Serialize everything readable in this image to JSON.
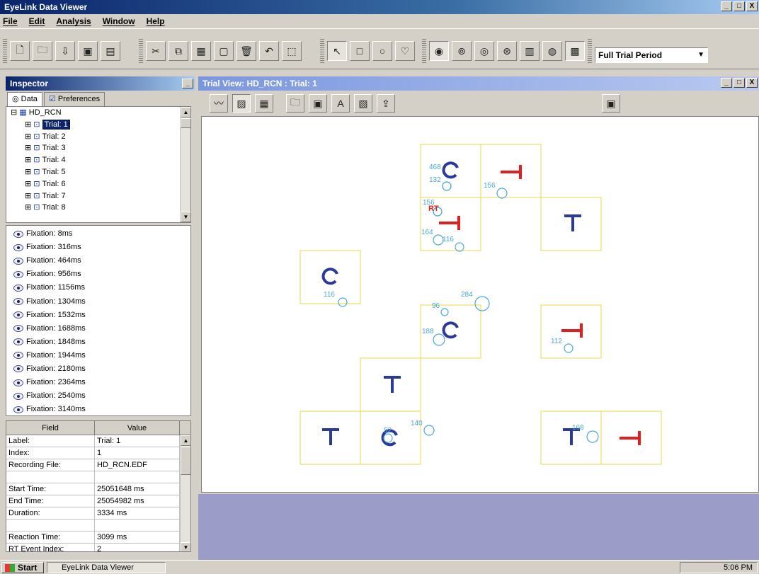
{
  "window": {
    "title": "EyeLink Data Viewer",
    "controls": [
      "_",
      "□",
      "X"
    ]
  },
  "menu": {
    "items": [
      "File",
      "Edit",
      "Analysis",
      "Window",
      "Help"
    ]
  },
  "toolbar": {
    "period_select": "Full Trial Period"
  },
  "inspector": {
    "title": "Inspector",
    "tabs": [
      "Data",
      "Preferences"
    ],
    "tree": {
      "root": "HD_RCN",
      "trials": [
        "Trial: 1",
        "Trial: 2",
        "Trial: 3",
        "Trial: 4",
        "Trial: 5",
        "Trial: 6",
        "Trial: 7",
        "Trial: 8"
      ]
    },
    "events": [
      "Fixation: 8ms",
      "Fixation: 316ms",
      "Fixation: 464ms",
      "Fixation: 956ms",
      "Fixation: 1156ms",
      "Fixation: 1304ms",
      "Fixation: 1532ms",
      "Fixation: 1688ms",
      "Fixation: 1848ms",
      "Fixation: 1944ms",
      "Fixation: 2180ms",
      "Fixation: 2364ms",
      "Fixation: 2540ms",
      "Fixation: 3140ms"
    ],
    "grid": {
      "headers": [
        "Field",
        "Value"
      ],
      "rows": [
        [
          "Label:",
          "Trial: 1"
        ],
        [
          "Index:",
          "1"
        ],
        [
          "Recording File:",
          "HD_RCN.EDF"
        ],
        [
          "",
          ""
        ],
        [
          "Start Time:",
          "25051648 ms"
        ],
        [
          "End Time:",
          "25054982 ms"
        ],
        [
          "Duration:",
          "3334 ms"
        ],
        [
          "",
          ""
        ],
        [
          "Reaction Time:",
          "3099 ms"
        ],
        [
          "RT Event Index:",
          "2"
        ]
      ]
    }
  },
  "trial_view": {
    "title": "Trial View: HD_RCN : Trial: 1",
    "fixation_labels": [
      "468",
      "132",
      "156",
      "156",
      "RT",
      "164",
      "116",
      "116",
      "96",
      "284",
      "188",
      "112",
      "140",
      "52",
      "168"
    ]
  },
  "taskbar": {
    "start": "Start",
    "app": "EyeLink Data Viewer",
    "clock": "5:06 PM"
  },
  "colors": {
    "title_active": "#0a246a",
    "title_inactive": "#7a96df",
    "box": "#e8d84a",
    "target_blue": "#2a3a9a",
    "target_red": "#e02020",
    "fixation": "#4aa8d8"
  }
}
